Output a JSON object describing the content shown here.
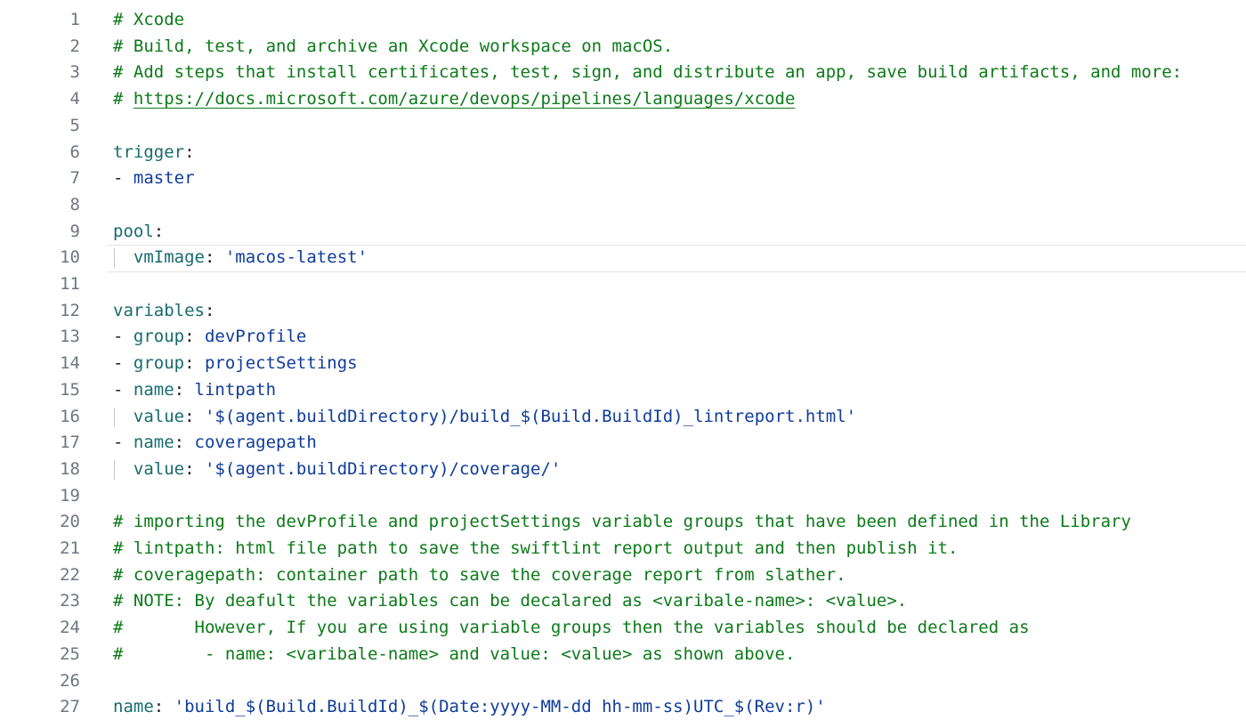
{
  "editor": {
    "lines": [
      {
        "n": "1",
        "segs": [
          {
            "c": "c",
            "t": "# Xcode"
          }
        ]
      },
      {
        "n": "2",
        "segs": [
          {
            "c": "c",
            "t": "# Build, test, and archive an Xcode workspace on macOS."
          }
        ]
      },
      {
        "n": "3",
        "segs": [
          {
            "c": "c",
            "t": "# Add steps that install certificates, test, sign, and distribute an app, save build artifacts, and more:"
          }
        ]
      },
      {
        "n": "4",
        "segs": [
          {
            "c": "c",
            "t": "# "
          },
          {
            "c": "c link",
            "t": "https://docs.microsoft.com/azure/devops/pipelines/languages/xcode"
          }
        ]
      },
      {
        "n": "5",
        "segs": []
      },
      {
        "n": "6",
        "segs": [
          {
            "c": "k",
            "t": "trigger"
          },
          {
            "c": "p",
            "t": ":"
          }
        ]
      },
      {
        "n": "7",
        "segs": [
          {
            "c": "p",
            "t": "- "
          },
          {
            "c": "v",
            "t": "master"
          }
        ]
      },
      {
        "n": "8",
        "segs": []
      },
      {
        "n": "9",
        "segs": [
          {
            "c": "k",
            "t": "pool"
          },
          {
            "c": "p",
            "t": ":"
          }
        ]
      },
      {
        "n": "10",
        "segs": [
          {
            "c": "p",
            "t": "  "
          },
          {
            "c": "k",
            "t": "vmImage"
          },
          {
            "c": "p",
            "t": ": "
          },
          {
            "c": "s",
            "t": "'macos-latest'"
          }
        ],
        "guide": true,
        "current": true
      },
      {
        "n": "11",
        "segs": []
      },
      {
        "n": "12",
        "segs": [
          {
            "c": "k",
            "t": "variables"
          },
          {
            "c": "p",
            "t": ":"
          }
        ]
      },
      {
        "n": "13",
        "segs": [
          {
            "c": "p",
            "t": "- "
          },
          {
            "c": "k",
            "t": "group"
          },
          {
            "c": "p",
            "t": ": "
          },
          {
            "c": "v",
            "t": "devProfile"
          }
        ]
      },
      {
        "n": "14",
        "segs": [
          {
            "c": "p",
            "t": "- "
          },
          {
            "c": "k",
            "t": "group"
          },
          {
            "c": "p",
            "t": ": "
          },
          {
            "c": "v",
            "t": "projectSettings"
          }
        ]
      },
      {
        "n": "15",
        "segs": [
          {
            "c": "p",
            "t": "- "
          },
          {
            "c": "k",
            "t": "name"
          },
          {
            "c": "p",
            "t": ": "
          },
          {
            "c": "v",
            "t": "lintpath"
          }
        ]
      },
      {
        "n": "16",
        "segs": [
          {
            "c": "p",
            "t": "  "
          },
          {
            "c": "k",
            "t": "value"
          },
          {
            "c": "p",
            "t": ": "
          },
          {
            "c": "s",
            "t": "'$(agent.buildDirectory)/build_$(Build.BuildId)_lintreport.html'"
          }
        ],
        "guide": true
      },
      {
        "n": "17",
        "segs": [
          {
            "c": "p",
            "t": "- "
          },
          {
            "c": "k",
            "t": "name"
          },
          {
            "c": "p",
            "t": ": "
          },
          {
            "c": "v",
            "t": "coveragepath"
          }
        ]
      },
      {
        "n": "18",
        "segs": [
          {
            "c": "p",
            "t": "  "
          },
          {
            "c": "k",
            "t": "value"
          },
          {
            "c": "p",
            "t": ": "
          },
          {
            "c": "s",
            "t": "'$(agent.buildDirectory)/coverage/'"
          }
        ],
        "guide": true
      },
      {
        "n": "19",
        "segs": []
      },
      {
        "n": "20",
        "segs": [
          {
            "c": "c",
            "t": "# importing the devProfile and projectSettings variable groups that have been defined in the Library"
          }
        ]
      },
      {
        "n": "21",
        "segs": [
          {
            "c": "c",
            "t": "# lintpath: html file path to save the swiftlint report output and then publish it."
          }
        ]
      },
      {
        "n": "22",
        "segs": [
          {
            "c": "c",
            "t": "# coveragepath: container path to save the coverage report from slather."
          }
        ]
      },
      {
        "n": "23",
        "segs": [
          {
            "c": "c",
            "t": "# NOTE: By deafult the variables can be decalared as <varibale-name>: <value>."
          }
        ]
      },
      {
        "n": "24",
        "segs": [
          {
            "c": "c",
            "t": "#       However, If you are using variable groups then the variables should be declared as"
          }
        ]
      },
      {
        "n": "25",
        "segs": [
          {
            "c": "c",
            "t": "#        - name: <varibale-name> and value: <value> as shown above."
          }
        ]
      },
      {
        "n": "26",
        "segs": []
      },
      {
        "n": "27",
        "segs": [
          {
            "c": "k",
            "t": "name"
          },
          {
            "c": "p",
            "t": ": "
          },
          {
            "c": "s",
            "t": "'build_$(Build.BuildId)_$(Date:yyyy-MM-dd hh-mm-ss)UTC_$(Rev:r)'"
          }
        ]
      }
    ]
  }
}
